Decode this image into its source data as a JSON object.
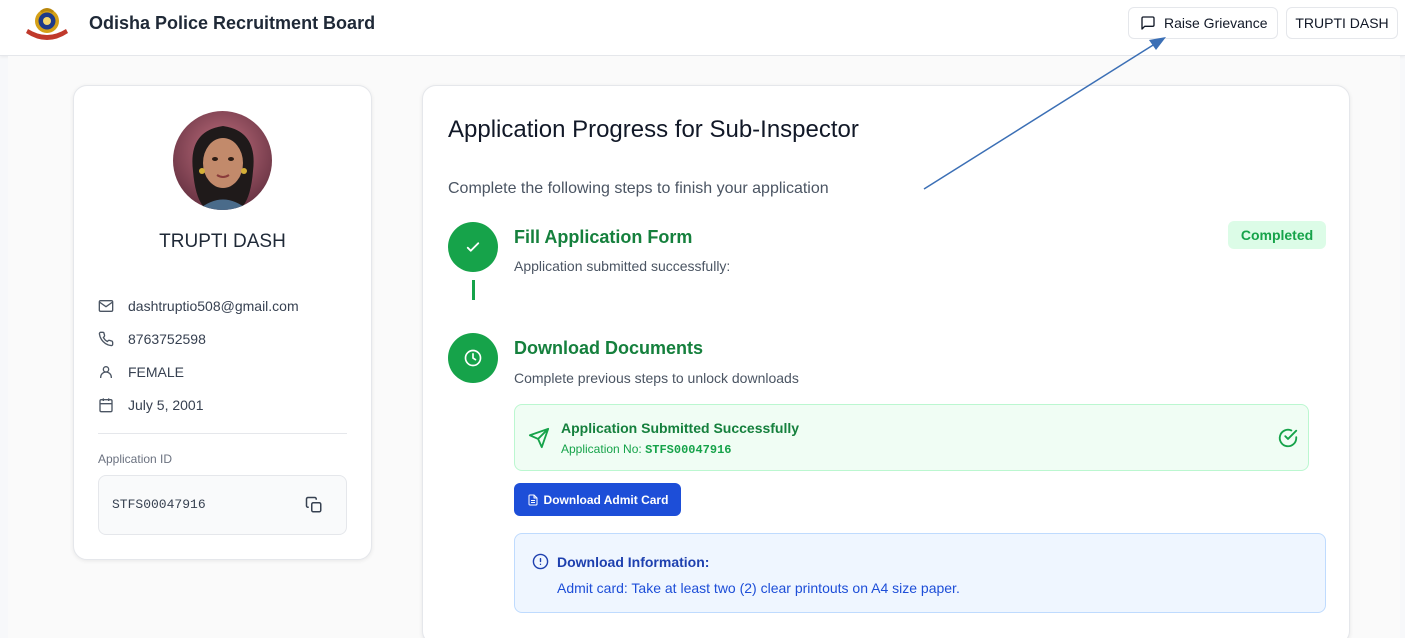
{
  "header": {
    "brand": "Odisha Police Recruitment Board",
    "grievance_label": "Raise Grievance",
    "user_label": "TRUPTI DASH"
  },
  "profile": {
    "name": "TRUPTI DASH",
    "email": "dashtruptio508@gmail.com",
    "phone": "8763752598",
    "gender": "FEMALE",
    "dob": "July 5, 2001",
    "app_id_label": "Application ID",
    "app_id": "STFS00047916"
  },
  "progress": {
    "title": "Application Progress for Sub-Inspector",
    "subtitle": "Complete the following steps to finish your application",
    "steps": [
      {
        "title": "Fill Application Form",
        "desc": "Application submitted successfully:",
        "badge": "Completed",
        "icon": "check-icon"
      },
      {
        "title": "Download Documents",
        "desc": "Complete previous steps to unlock downloads",
        "icon": "clock-icon"
      }
    ],
    "success": {
      "title": "Application Submitted Successfully",
      "app_no_label": "Application No:",
      "app_no": "STFS00047916"
    },
    "download_btn": "Download Admit Card",
    "info": {
      "title": "Download Information:",
      "text": "Admit card: Take at least two (2) clear printouts on A4 size paper."
    }
  },
  "colors": {
    "green": "#16a34a",
    "blue": "#1d4ed8",
    "annotation_arrow": "#3b6fb5"
  }
}
